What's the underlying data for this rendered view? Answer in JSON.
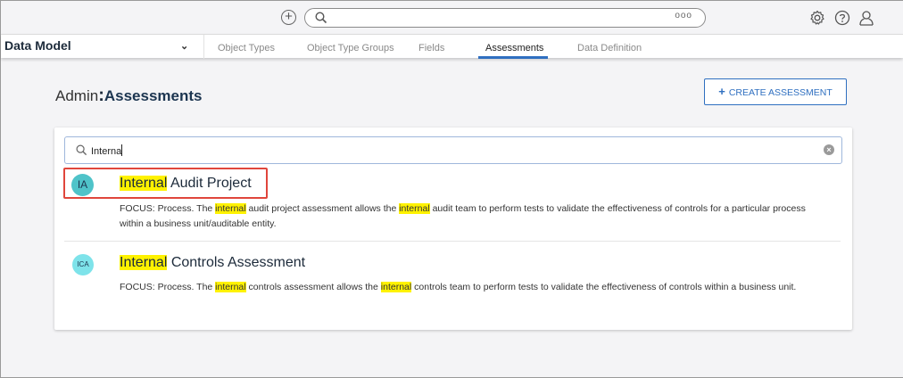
{
  "topbar": {
    "add_icon": "plus-circle-icon",
    "search_icon": "search-icon",
    "more_icon": "more-dots-icon",
    "more_text": "ooo",
    "settings_icon": "gear-icon",
    "help_icon": "help-icon",
    "user_icon": "user-icon"
  },
  "nav": {
    "module": "Data Model",
    "tabs": [
      {
        "label": "Object Types"
      },
      {
        "label": "Object Type Groups"
      },
      {
        "label": "Fields"
      },
      {
        "label": "Assessments",
        "active": true
      },
      {
        "label": "Data Definition"
      }
    ]
  },
  "page": {
    "title_prefix": "Admin",
    "title_sep": ":",
    "title": "Assessments",
    "create_plus": "+",
    "create_label": "CREATE ASSESSMENT"
  },
  "search": {
    "value": "Interna"
  },
  "results": [
    {
      "initials": "IA",
      "title_match": "Internal",
      "title_rest": " Audit Project",
      "desc": [
        {
          "t": "FOCUS: Process. The ",
          "h": false
        },
        {
          "t": "internal",
          "h": true
        },
        {
          "t": " audit project assessment allows the ",
          "h": false
        },
        {
          "t": "internal",
          "h": true
        },
        {
          "t": " audit team to perform tests to validate the effectiveness of controls for a particular process within a business unit/auditable entity.",
          "h": false
        }
      ]
    },
    {
      "initials": "ICA",
      "title_match": "Internal",
      "title_rest": " Controls Assessment",
      "desc": [
        {
          "t": "FOCUS: Process. The ",
          "h": false
        },
        {
          "t": "internal",
          "h": true
        },
        {
          "t": " controls assessment allows the ",
          "h": false
        },
        {
          "t": "internal",
          "h": true
        },
        {
          "t": " controls team to perform tests to validate the effectiveness of controls within a business unit.",
          "h": false
        }
      ]
    }
  ],
  "colors": {
    "accent": "#2f6fc0",
    "highlight": "#fff200",
    "callout": "#e0463c",
    "avatar_ia": "#4fc3c9",
    "avatar_ica": "#7ee3ea"
  }
}
